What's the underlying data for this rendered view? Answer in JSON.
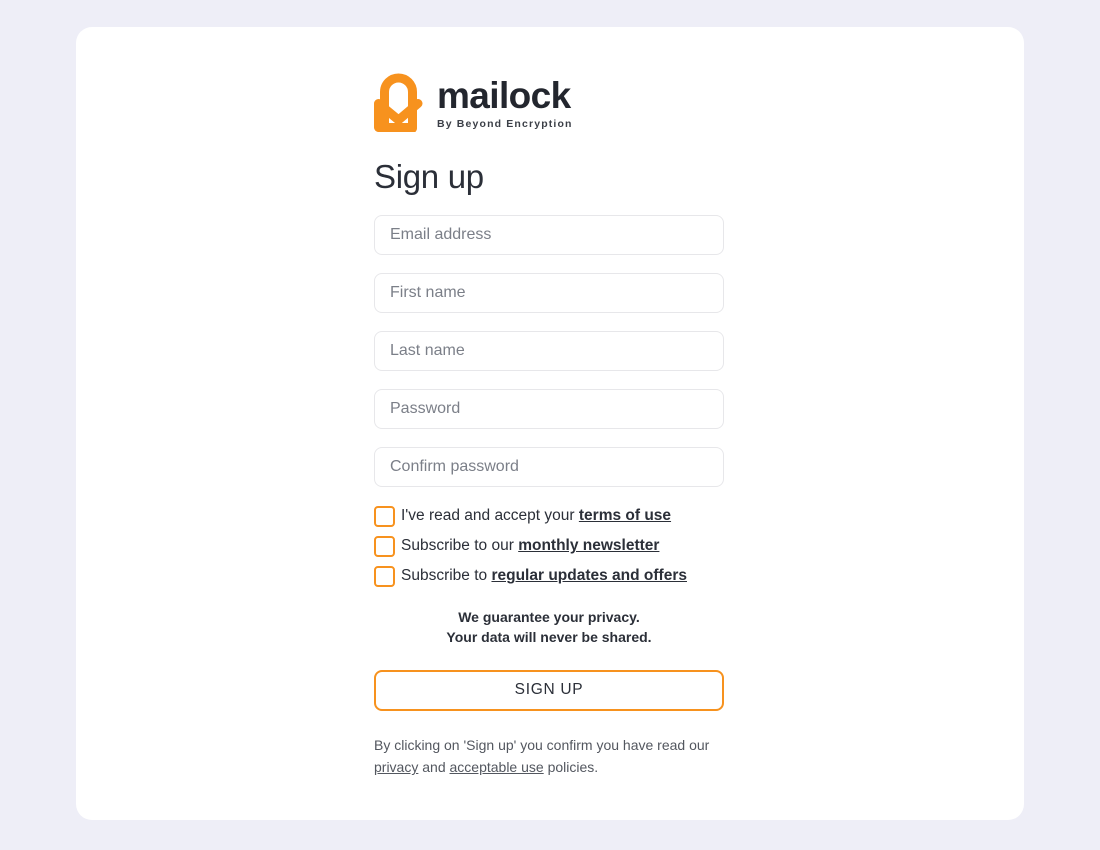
{
  "page": {
    "background_color": "#eeeef7",
    "card_background_color": "#ffffff",
    "accent_color": "#f7921e"
  },
  "brand": {
    "name": "mailock",
    "tagline": "By Beyond Encryption",
    "logo_icon": "mailock-padlock-envelope-logo"
  },
  "heading": "Sign up",
  "fields": [
    {
      "name": "email",
      "placeholder": "Email address",
      "value": ""
    },
    {
      "name": "first_name",
      "placeholder": "First name",
      "value": ""
    },
    {
      "name": "last_name",
      "placeholder": "Last name",
      "value": ""
    },
    {
      "name": "password",
      "placeholder": "Password",
      "value": ""
    },
    {
      "name": "confirm_password",
      "placeholder": "Confirm password",
      "value": ""
    }
  ],
  "checkboxes": [
    {
      "name": "terms",
      "text_before": "I've read and accept your ",
      "link": "terms of use",
      "text_after": "",
      "checked": false
    },
    {
      "name": "newsletter",
      "text_before": "Subscribe to our ",
      "link": "monthly newsletter",
      "text_after": "",
      "checked": false
    },
    {
      "name": "offers",
      "text_before": "Subscribe to ",
      "link": "regular updates and offers",
      "text_after": "",
      "checked": false
    }
  ],
  "guarantee": {
    "line1": "We guarantee your privacy.",
    "line2": "Your data will never be shared."
  },
  "submit_label": "SIGN UP",
  "footer": {
    "part1": "By clicking on 'Sign up' you confirm you have read our ",
    "link1": "privacy",
    "part2": " and ",
    "link2": "acceptable use",
    "part3": " policies."
  }
}
